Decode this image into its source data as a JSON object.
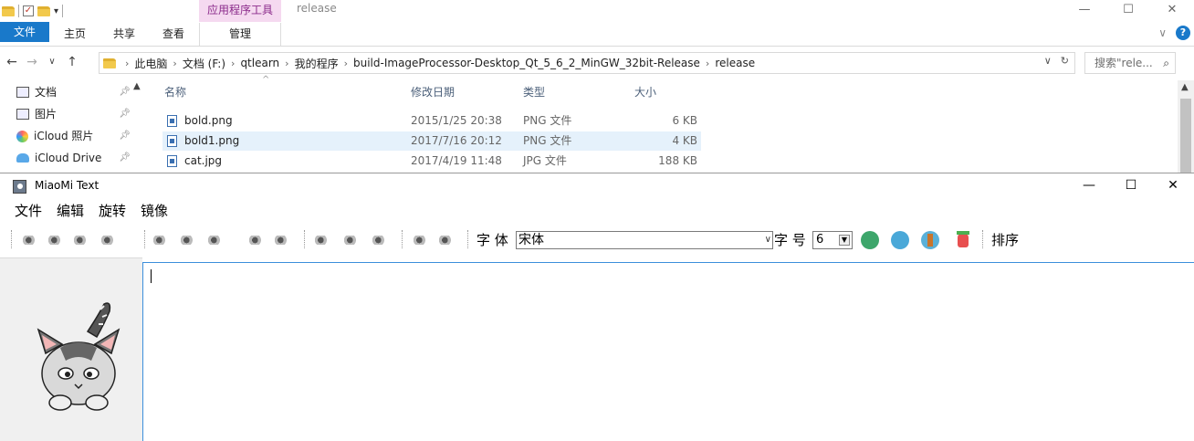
{
  "explorer": {
    "context_tab": "应用程序工具",
    "window_title": "release",
    "controls": {
      "minimize": "—",
      "maximize": "☐",
      "close": "✕"
    },
    "ribbon": {
      "file": "文件",
      "home": "主页",
      "share": "共享",
      "view": "查看",
      "manage": "管理",
      "expand": "∨",
      "help": "?"
    },
    "nav": {
      "back": "←",
      "forward": "→",
      "recent": "∨",
      "up": "↑"
    },
    "breadcrumbs": [
      "此电脑",
      "文档 (F:)",
      "qtlearn",
      "我的程序",
      "build-ImageProcessor-Desktop_Qt_5_6_2_MinGW_32bit-Release",
      "release"
    ],
    "search_placeholder": "搜索\"rele...",
    "nav_pane": [
      {
        "label": "文档",
        "icon": "documents-icon"
      },
      {
        "label": "图片",
        "icon": "pictures-icon"
      },
      {
        "label": "iCloud 照片",
        "icon": "icloud-photos-icon"
      },
      {
        "label": "iCloud Drive",
        "icon": "icloud-drive-icon"
      }
    ],
    "columns": {
      "name": "名称",
      "date": "修改日期",
      "type": "类型",
      "size": "大小"
    },
    "files": [
      {
        "name": "bold.png",
        "date": "2015/1/25 20:38",
        "type": "PNG 文件",
        "size": "6 KB"
      },
      {
        "name": "bold1.png",
        "date": "2017/7/16 20:12",
        "type": "PNG 文件",
        "size": "4 KB"
      },
      {
        "name": "cat.jpg",
        "date": "2017/4/19 11:48",
        "type": "JPG 文件",
        "size": "188 KB"
      }
    ]
  },
  "miaomi": {
    "title": "MiaoMi Text",
    "controls": {
      "minimize": "—",
      "maximize": "☐",
      "close": "✕"
    },
    "menu": [
      "文件",
      "编辑",
      "旋转",
      "镜像"
    ],
    "toolbar": {
      "font_label": "字 体",
      "font_value": "宋体",
      "size_label": "字 号",
      "size_value": "6",
      "sort_label": "排序"
    },
    "accent_colors": {
      "selection": "#e5f1fb",
      "editor_border": "#3c8fdb",
      "file_tab": "#1979ca"
    }
  }
}
